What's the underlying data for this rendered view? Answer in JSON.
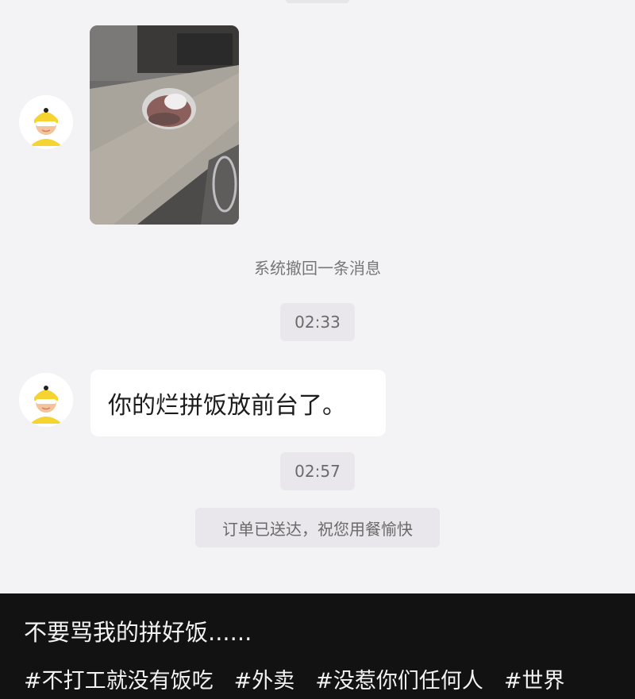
{
  "chat": {
    "system_recall": "系统撤回一条消息",
    "time_1": "02:33",
    "message_text": "你的烂拼饭放前台了。",
    "time_2": "02:57",
    "delivered": "订单已送达，祝您用餐愉快"
  },
  "icons": {
    "sender_avatar": "courier-avatar-icon"
  },
  "colors": {
    "chat_background": "#f3f2f4",
    "bubble": "#ffffff",
    "caption_background": "#121212",
    "avatar_accent": "#f5d431"
  },
  "caption": {
    "title": "不要骂我的拼好饭......",
    "hashtags": [
      "#不打工就没有饭吃",
      "#外卖",
      "#没惹你们任何人",
      "#世界"
    ]
  }
}
